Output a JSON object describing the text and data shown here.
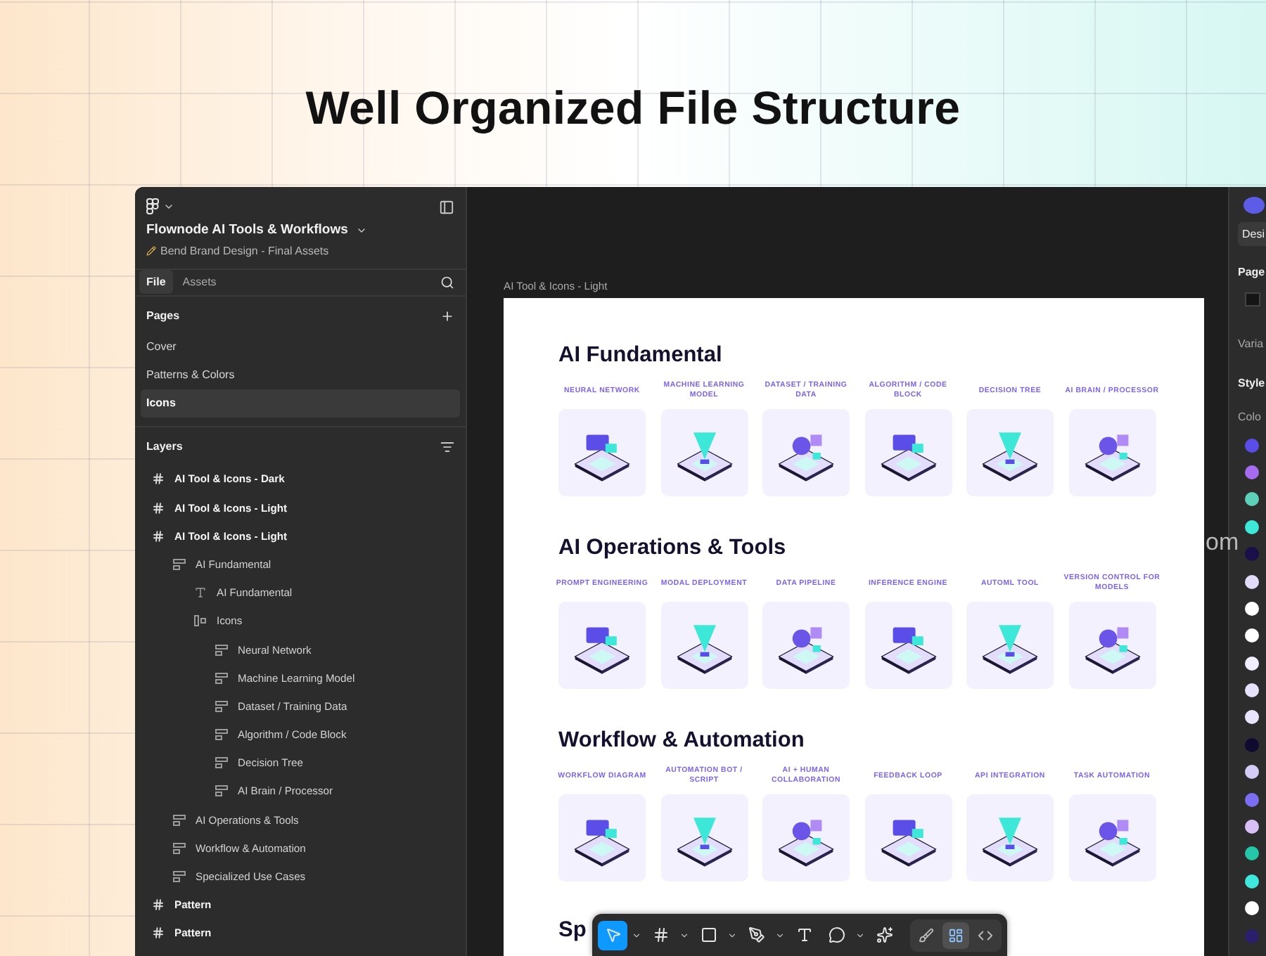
{
  "page_heading": "Well Organized File Structure",
  "file": {
    "name": "Flownode AI Tools & Workflows",
    "subtitle": "Bend Brand Design - Final Assets"
  },
  "sidebar_tabs": [
    {
      "label": "File",
      "selected": true
    },
    {
      "label": "Assets",
      "selected": false
    }
  ],
  "pages": {
    "title": "Pages",
    "items": [
      {
        "label": "Cover",
        "selected": false
      },
      {
        "label": "Patterns & Colors",
        "selected": false
      },
      {
        "label": "Icons",
        "selected": true
      }
    ]
  },
  "layers": {
    "title": "Layers",
    "items": [
      {
        "label": "AI Tool & Icons - Dark",
        "kind": "frame"
      },
      {
        "label": "AI Tool & Icons - Light",
        "kind": "frame"
      },
      {
        "label": "AI Tool & Icons - Light",
        "kind": "frame",
        "children": [
          {
            "label": "AI Fundamental",
            "kind": "group",
            "children": [
              {
                "label": "AI Fundamental",
                "kind": "text"
              },
              {
                "label": "Icons",
                "kind": "stack",
                "children": [
                  {
                    "label": "Neural Network",
                    "kind": "group"
                  },
                  {
                    "label": "Machine Learning Model",
                    "kind": "group"
                  },
                  {
                    "label": "Dataset / Training Data",
                    "kind": "group"
                  },
                  {
                    "label": "Algorithm / Code Block",
                    "kind": "group"
                  },
                  {
                    "label": "Decision Tree",
                    "kind": "group"
                  },
                  {
                    "label": "AI Brain / Processor",
                    "kind": "group"
                  }
                ]
              }
            ]
          },
          {
            "label": "AI Operations & Tools",
            "kind": "group"
          },
          {
            "label": "Workflow & Automation",
            "kind": "group"
          },
          {
            "label": "Specialized Use Cases",
            "kind": "group"
          }
        ]
      },
      {
        "label": "Pattern",
        "kind": "frame"
      },
      {
        "label": "Pattern",
        "kind": "frame"
      }
    ]
  },
  "canvas": {
    "frame_label": "AI Tool & Icons - Light",
    "edge_text": "om",
    "partial_section_title": "Sp",
    "sections": [
      {
        "title": "AI Fundamental",
        "items": [
          {
            "label": "NEURAL NETWORK"
          },
          {
            "label": "MACHINE LEARNING MODEL"
          },
          {
            "label": "DATASET / TRAINING DATA"
          },
          {
            "label": "ALGORITHM / CODE BLOCK"
          },
          {
            "label": "DECISION TREE"
          },
          {
            "label": "AI BRAIN / PROCESSOR"
          }
        ]
      },
      {
        "title": "AI Operations & Tools",
        "items": [
          {
            "label": "PROMPT ENGINEERING"
          },
          {
            "label": "MODAL DEPLOYMENT"
          },
          {
            "label": "DATA PIPELINE"
          },
          {
            "label": "INFERENCE ENGINE"
          },
          {
            "label": "AUTOML TOOL"
          },
          {
            "label": "VERSION CONTROL FOR MODELS"
          }
        ]
      },
      {
        "title": "Workflow & Automation",
        "items": [
          {
            "label": "WORKFLOW DIAGRAM"
          },
          {
            "label": "AUTOMATION BOT / SCRIPT"
          },
          {
            "label": "AI + HUMAN COLLABORATION"
          },
          {
            "label": "FEEDBACK LOOP"
          },
          {
            "label": "API INTEGRATION"
          },
          {
            "label": "TASK AUTOMATION"
          }
        ]
      }
    ]
  },
  "toolbar": {
    "tools": [
      {
        "kind": "move",
        "selected": true
      },
      {
        "kind": "frame",
        "selected": false
      },
      {
        "kind": "rectangle",
        "selected": false
      },
      {
        "kind": "pen",
        "selected": false
      },
      {
        "kind": "text",
        "selected": false
      },
      {
        "kind": "comment",
        "selected": false
      },
      {
        "kind": "ai",
        "selected": false
      }
    ],
    "modes": [
      {
        "kind": "draw",
        "selected": false
      },
      {
        "kind": "dev",
        "selected": true
      },
      {
        "kind": "code",
        "selected": false
      }
    ]
  },
  "right_panel": {
    "tab": "Desi",
    "page_title": "Page",
    "variables_title": "Varia",
    "styles_title": "Style",
    "colors_title": "Colo",
    "swatches": [
      {
        "color": "#5b4ee8"
      },
      {
        "color": "#a66cf0"
      },
      {
        "color": "#5ecfb8"
      },
      {
        "color": "#3ee8d8"
      },
      {
        "color": "#1a0f4a"
      },
      {
        "color": "#e2dcf8"
      },
      {
        "color": "#ffffff"
      },
      {
        "color": "#ffffff"
      },
      {
        "color": "#f0eefc"
      },
      {
        "color": "#e6e2fb"
      },
      {
        "color": "#e8e4fb"
      },
      {
        "color": "#0e0a30"
      },
      {
        "color": "#d4ccf6"
      },
      {
        "color": "#7b6ef0"
      },
      {
        "color": "#d8bff5"
      },
      {
        "color": "#26c7a8"
      },
      {
        "color": "#3ee8dc"
      },
      {
        "color": "#ffffff"
      },
      {
        "color": "#2a1f6a"
      }
    ]
  }
}
